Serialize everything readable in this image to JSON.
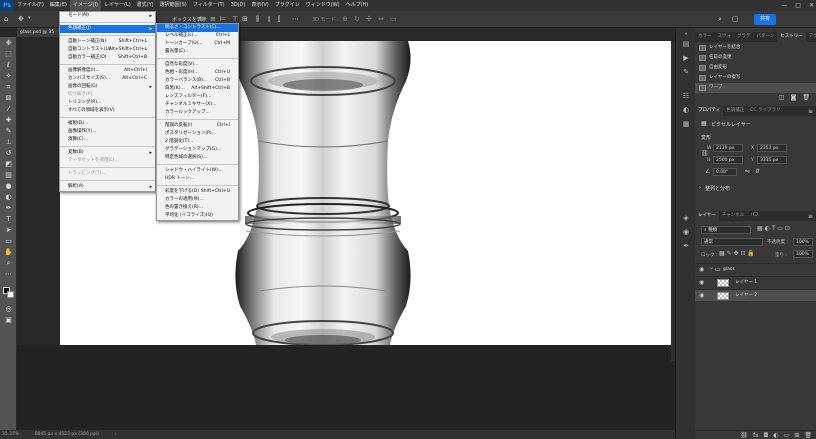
{
  "app": {
    "logo": "Ps"
  },
  "menubar": [
    {
      "label": "ファイル(F)"
    },
    {
      "label": "編集(E)"
    },
    {
      "label": "イメージ(I)",
      "active": true
    },
    {
      "label": "レイヤー(L)"
    },
    {
      "label": "書式(Y)"
    },
    {
      "label": "選択範囲(S)"
    },
    {
      "label": "フィルター(T)"
    },
    {
      "label": "3D(D)"
    },
    {
      "label": "表示(V)"
    },
    {
      "label": "プラグイン"
    },
    {
      "label": "ウィンドウ(W)"
    },
    {
      "label": "ヘルプ(H)"
    }
  ],
  "window_controls": {
    "minimize": "—",
    "maximize": "□",
    "close": "✕"
  },
  "options_bar": {
    "transform_label": "ボックスを表示",
    "mode_3d": "3D モード :",
    "share_label": "共有"
  },
  "document_tab": {
    "label": "glass.psd @ 35"
  },
  "image_menu": [
    {
      "label": "モード(M)",
      "submenu": true
    },
    {
      "sep": true
    },
    {
      "label": "色調補正(J)",
      "submenu": true,
      "highlight": true
    },
    {
      "sep": true
    },
    {
      "label": "自動トーン補正(N)",
      "shortcut": "Shift+Ctrl+L"
    },
    {
      "label": "自動コントラスト(U)",
      "shortcut": "Alt+Shift+Ctrl+L"
    },
    {
      "label": "自動カラー補正(O)",
      "shortcut": "Shift+Ctrl+B"
    },
    {
      "sep": true
    },
    {
      "label": "画像解像度(I)...",
      "shortcut": "Alt+Ctrl+I"
    },
    {
      "label": "カンバスサイズ(S)...",
      "shortcut": "Alt+Ctrl+C"
    },
    {
      "label": "画像の回転(G)",
      "submenu": true
    },
    {
      "label": "切り抜き(P)",
      "disabled": true
    },
    {
      "label": "トリミング(R)..."
    },
    {
      "label": "すべての領域を表示(V)"
    },
    {
      "sep": true
    },
    {
      "label": "複製(D)..."
    },
    {
      "label": "画像操作(Y)..."
    },
    {
      "label": "演算(C)..."
    },
    {
      "sep": true
    },
    {
      "label": "変数(B)",
      "submenu": true
    },
    {
      "label": "データセットを適用(L)...",
      "disabled": true
    },
    {
      "sep": true
    },
    {
      "label": "トラッピング(T)...",
      "disabled": true
    },
    {
      "sep": true
    },
    {
      "label": "解析(A)",
      "submenu": true
    }
  ],
  "adjust_menu": [
    {
      "label": "明るさ・コントラスト(C)...",
      "highlight": true
    },
    {
      "label": "レベル補正(L)...",
      "shortcut": "Ctrl+L"
    },
    {
      "label": "トーンカーブ(U)...",
      "shortcut": "Ctrl+M"
    },
    {
      "label": "露光量(E)..."
    },
    {
      "sep": true
    },
    {
      "label": "自然な彩度(V)..."
    },
    {
      "label": "色相・彩度(H)...",
      "shortcut": "Ctrl+U"
    },
    {
      "label": "カラーバランス(B)...",
      "shortcut": "Ctrl+B"
    },
    {
      "label": "白黒(K)...",
      "shortcut": "Alt+Shift+Ctrl+B"
    },
    {
      "label": "レンズフィルター(F)..."
    },
    {
      "label": "チャンネルミキサー(X)..."
    },
    {
      "label": "カラールックアップ..."
    },
    {
      "sep": true
    },
    {
      "label": "階調の反転(I)",
      "shortcut": "Ctrl+I"
    },
    {
      "label": "ポスタリゼーション(P)..."
    },
    {
      "label": "2 階調化(T)..."
    },
    {
      "label": "グラデーションマップ(G)..."
    },
    {
      "label": "特定色域の選択(S)..."
    },
    {
      "sep": true
    },
    {
      "label": "シャドウ・ハイライト(W)..."
    },
    {
      "label": "HDR トーン..."
    },
    {
      "sep": true
    },
    {
      "label": "彩度を下げる(D)",
      "shortcut": "Shift+Ctrl+U"
    },
    {
      "label": "カラーの適用(M)..."
    },
    {
      "label": "色の置き換え(R)..."
    },
    {
      "label": "平均化 (イコライズ)(Q)"
    }
  ],
  "panel_tabs_top": [
    {
      "label": "カラー"
    },
    {
      "label": "スウォ"
    },
    {
      "label": "グラデ"
    },
    {
      "label": "パターン"
    },
    {
      "label": "ヒストリー",
      "active": true
    },
    {
      "label": "アクシ"
    },
    {
      "label": "コメン"
    }
  ],
  "history": [
    {
      "label": "レイヤーを結合"
    },
    {
      "label": "名前の変更"
    },
    {
      "label": "自由変形"
    },
    {
      "label": "レイヤーの複写"
    },
    {
      "label": "ワープ",
      "selected": true
    }
  ],
  "panel_tabs_mid": [
    {
      "label": "プロパティ",
      "active": true
    },
    {
      "label": "色調補正"
    },
    {
      "label": "CC ライブラリ"
    }
  ],
  "properties": {
    "layer_type": "ピクセルレイヤー",
    "section_transform": "変形",
    "w_label": "W",
    "w_value": "2139 px",
    "h_label": "H",
    "h_value": "2500 px",
    "x_label": "X",
    "x_value": "2353 px",
    "y_label": "Y",
    "y_value": "3335 px",
    "angle_value": "0.00°",
    "section_align": "整列と分布"
  },
  "panel_tabs_layers": [
    {
      "label": "レイヤー",
      "active": true
    },
    {
      "label": "チャンネル"
    },
    {
      "label": "パス"
    }
  ],
  "layers_panel": {
    "kind_label": "種類",
    "blend_mode": "通常",
    "opacity_label": "不透明度 :",
    "opacity_value": "100%",
    "lock_label": "ロック :",
    "fill_label": "塗り :",
    "fill_value": "100%"
  },
  "layers": [
    {
      "label": "glass",
      "group": true
    },
    {
      "label": "レイヤー 1"
    },
    {
      "label": "レイヤー 2",
      "selected": true
    }
  ],
  "status": {
    "zoom": "35.37%",
    "doc_size": "6845 px x 4523 px (300 ppi)"
  }
}
